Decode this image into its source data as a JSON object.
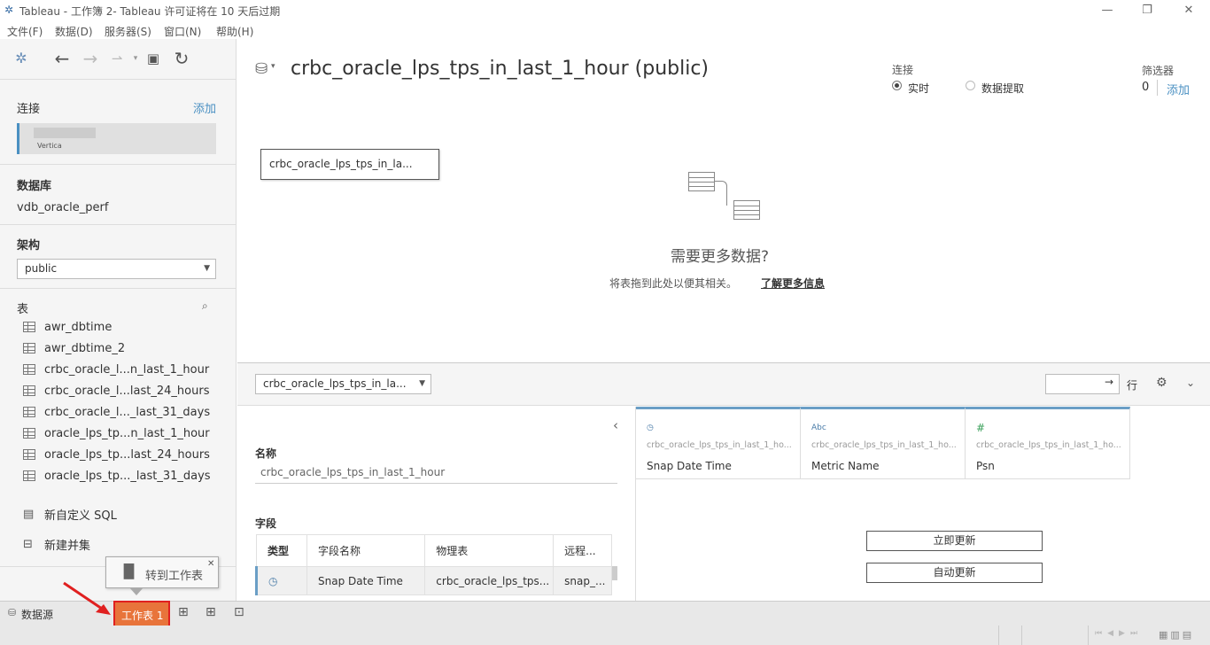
{
  "window": {
    "title": "Tableau - 工作簿 2- Tableau 许可证将在 10 天后过期"
  },
  "menu": [
    "文件(F)",
    "数据(D)",
    "服务器(S)",
    "窗口(N)",
    "帮助(H)"
  ],
  "sidebar": {
    "connections_label": "连接",
    "add_label": "添加",
    "connection_type": "Vertica",
    "database_label": "数据库",
    "database_value": "vdb_oracle_perf",
    "schema_label": "架构",
    "schema_value": "public",
    "tables_label": "表",
    "tables": [
      "awr_dbtime",
      "awr_dbtime_2",
      "crbc_oracle_l...n_last_1_hour",
      "crbc_oracle_l...last_24_hours",
      "crbc_oracle_l..._last_31_days",
      "oracle_lps_tp...n_last_1_hour",
      "oracle_lps_tp...last_24_hours",
      "oracle_lps_tp..._last_31_days"
    ],
    "new_custom_sql": "新自定义 SQL",
    "new_union": "新建并集"
  },
  "canvas": {
    "datasource_title": "crbc_oracle_lps_tps_in_last_1_hour (public)",
    "connection_label": "连接",
    "live_label": "实时",
    "extract_label": "数据提取",
    "filters_label": "筛选器",
    "filters_count": "0",
    "filters_add": "添加",
    "table_box": "crbc_oracle_lps_tps_in_la...",
    "need_more_title": "需要更多数据?",
    "need_more_text": "将表拖到此处以便其相关。",
    "learn_more": "了解更多信息"
  },
  "grid_toolbar": {
    "table_select": "crbc_oracle_lps_tps_in_la...",
    "rows_label": "行"
  },
  "meta": {
    "name_label": "名称",
    "name_value": "crbc_oracle_lps_tps_in_last_1_hour",
    "fields_label": "字段",
    "headers": [
      "类型",
      "字段名称",
      "物理表",
      "远程..."
    ],
    "row": {
      "name": "Snap Date Time",
      "table": "crbc_oracle_lps_tps...",
      "remote": "snap_..."
    }
  },
  "columns": [
    {
      "type": "",
      "source": "crbc_oracle_lps_tps_in_last_1_ho...",
      "name": "Snap Date Time"
    },
    {
      "type": "Abc",
      "source": "crbc_oracle_lps_tps_in_last_1_ho...",
      "name": "Metric Name"
    },
    {
      "type": "#",
      "source": "crbc_oracle_lps_tps_in_last_1_ho...",
      "name": "Psn"
    }
  ],
  "buttons": {
    "update_now": "立即更新",
    "auto_update": "自动更新"
  },
  "bottom": {
    "datasource_tab": "数据源",
    "sheet_tab": "工作表 1",
    "tooltip": "转到工作表"
  },
  "colors": {
    "accent": "#4a90c2",
    "sheet_tab": "#e8743b",
    "highlight_border": "#e02020"
  }
}
